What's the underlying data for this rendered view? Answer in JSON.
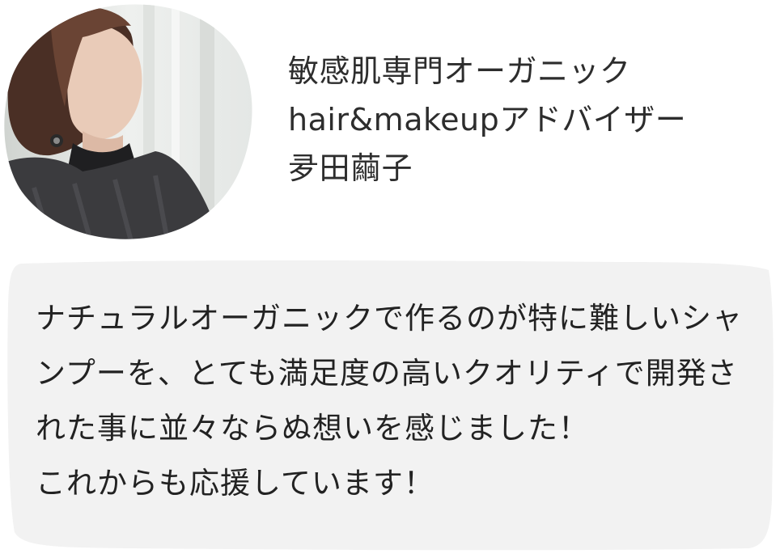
{
  "profile": {
    "title": "敏感肌専門オーガニック",
    "role": "hair&makeupアドバイザー",
    "name": "夛田繭子"
  },
  "photo": {
    "description_icon": "portrait-photo",
    "colors": {
      "background": "#e9ecea",
      "curtain": "#d8dcd9",
      "hair": "#5a3a2c",
      "skin": "#e8c8b5",
      "sweater": "#3a3a3c"
    }
  },
  "message": {
    "lines": [
      "ナチュラルオーガニックで作るのが特に難しいシャ",
      "ンプーを、とても満足度の高いクオリティで開発さ",
      "れた事に並々ならぬ想いを感じました！",
      "これからも応援しています！"
    ]
  },
  "colors": {
    "bubble_fill": "#f2f2f2",
    "text": "#222222"
  }
}
